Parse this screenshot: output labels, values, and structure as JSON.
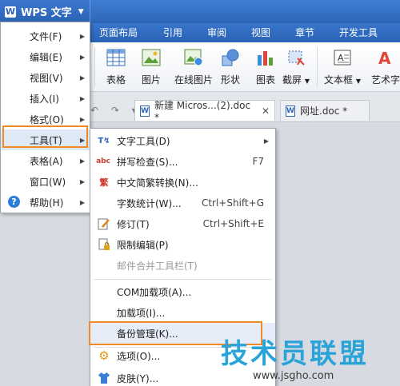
{
  "app": {
    "button_label": "WPS 文字"
  },
  "ribbon_tabs": [
    "页面布局",
    "引用",
    "审阅",
    "视图",
    "章节",
    "开发工具"
  ],
  "ribbon_items": [
    {
      "label": "表格",
      "icon": "table-icon"
    },
    {
      "label": "图片",
      "icon": "picture-icon"
    },
    {
      "label": "在线图片",
      "icon": "online-picture-icon"
    },
    {
      "label": "形状",
      "icon": "shapes-icon"
    },
    {
      "label": "图表",
      "icon": "chart-icon"
    },
    {
      "label": "截屏",
      "icon": "screenshot-icon"
    },
    {
      "label": "文本框",
      "icon": "textbox-icon"
    },
    {
      "label": "艺术字",
      "icon": "wordart-icon"
    }
  ],
  "doc_tabs": [
    {
      "label": "新建 Micros...(2).doc *",
      "active": true
    },
    {
      "label": "网址.doc *",
      "active": false
    }
  ],
  "main_menu": [
    {
      "label": "文件(F)"
    },
    {
      "label": "编辑(E)"
    },
    {
      "label": "视图(V)"
    },
    {
      "label": "插入(I)"
    },
    {
      "label": "格式(O)"
    },
    {
      "label": "工具(T)",
      "highlighted": true
    },
    {
      "label": "表格(A)"
    },
    {
      "label": "窗口(W)"
    },
    {
      "label": "帮助(H)",
      "icon": "help-icon"
    }
  ],
  "tools_submenu": [
    {
      "label": "文字工具(D)",
      "icon": "text-tools-icon",
      "has_submenu": true
    },
    {
      "label": "拼写检查(S)...",
      "icon": "spellcheck-icon",
      "shortcut": "F7"
    },
    {
      "label": "中文简繁转换(N)...",
      "icon": "chinese-convert-icon"
    },
    {
      "label": "字数统计(W)...",
      "shortcut": "Ctrl+Shift+G"
    },
    {
      "label": "修订(T)",
      "icon": "revision-icon",
      "shortcut": "Ctrl+Shift+E"
    },
    {
      "label": "限制编辑(P)",
      "icon": "lock-icon"
    },
    {
      "label": "邮件合并工具栏(T)",
      "disabled": true
    },
    {
      "label": "COM加载项(A)..."
    },
    {
      "label": "加载项(I)..."
    },
    {
      "label": "备份管理(K)...",
      "highlighted": true
    },
    {
      "label": "选项(O)...",
      "icon": "gear-icon"
    },
    {
      "label": "皮肤(Y)...",
      "icon": "shirt-icon"
    }
  ],
  "watermark": {
    "title": "技术员联盟",
    "url": "www.jsgho.com"
  },
  "colors": {
    "accent_blue": "#2c65b8",
    "highlight_orange": "#f08a24",
    "watermark_blue": "#2aa4d8"
  }
}
